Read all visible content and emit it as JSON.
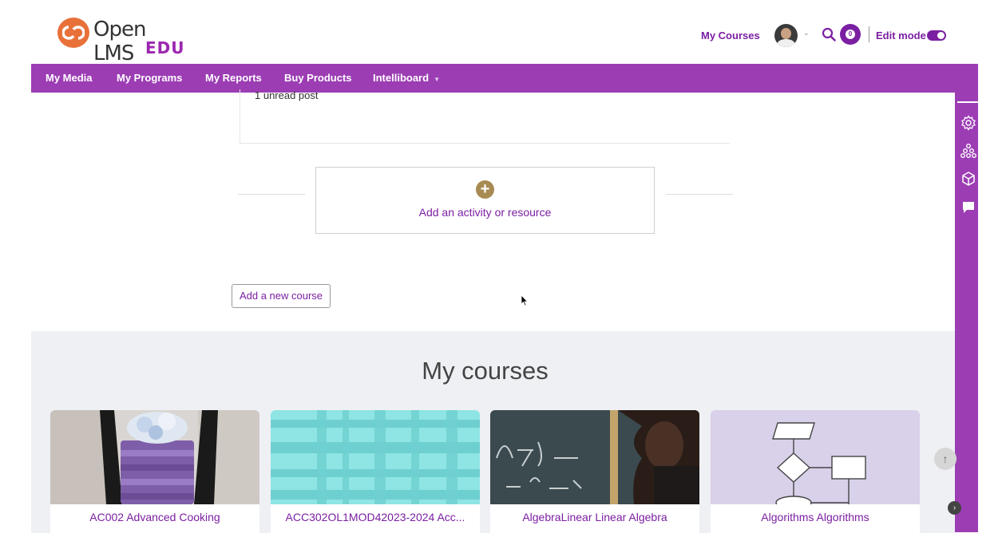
{
  "header": {
    "logo_text": "Open LMS",
    "logo_edu": "EDU",
    "my_courses_link": "My Courses",
    "notification_count": "0",
    "edit_mode_label": "Edit mode",
    "edit_mode_on": true
  },
  "nav": {
    "items": [
      {
        "label": "My Media"
      },
      {
        "label": "My Programs"
      },
      {
        "label": "My Reports"
      },
      {
        "label": "Buy Products"
      },
      {
        "label": "Intelliboard",
        "has_dropdown": true
      }
    ]
  },
  "drawer": {
    "icons": [
      "gear-icon",
      "sitemap-icon",
      "cube-icon",
      "comment-icon"
    ]
  },
  "main": {
    "unread_post": "1 unread post",
    "add_activity_label": "Add an activity or resource",
    "add_course_button": "Add a new course"
  },
  "courses": {
    "title": "My courses",
    "cards": [
      {
        "title": "AC002 Advanced Cooking"
      },
      {
        "title": "ACC302OL1MOD42023-2024 Acc..."
      },
      {
        "title": "AlgebraLinear Linear Algebra"
      },
      {
        "title": "Algorithms Algorithms"
      }
    ]
  },
  "colors": {
    "brand_purple": "#9c3db4",
    "link_purple": "#7b1fa2",
    "logo_orange": "#e8713a",
    "add_icon_gold": "#a88b52"
  }
}
